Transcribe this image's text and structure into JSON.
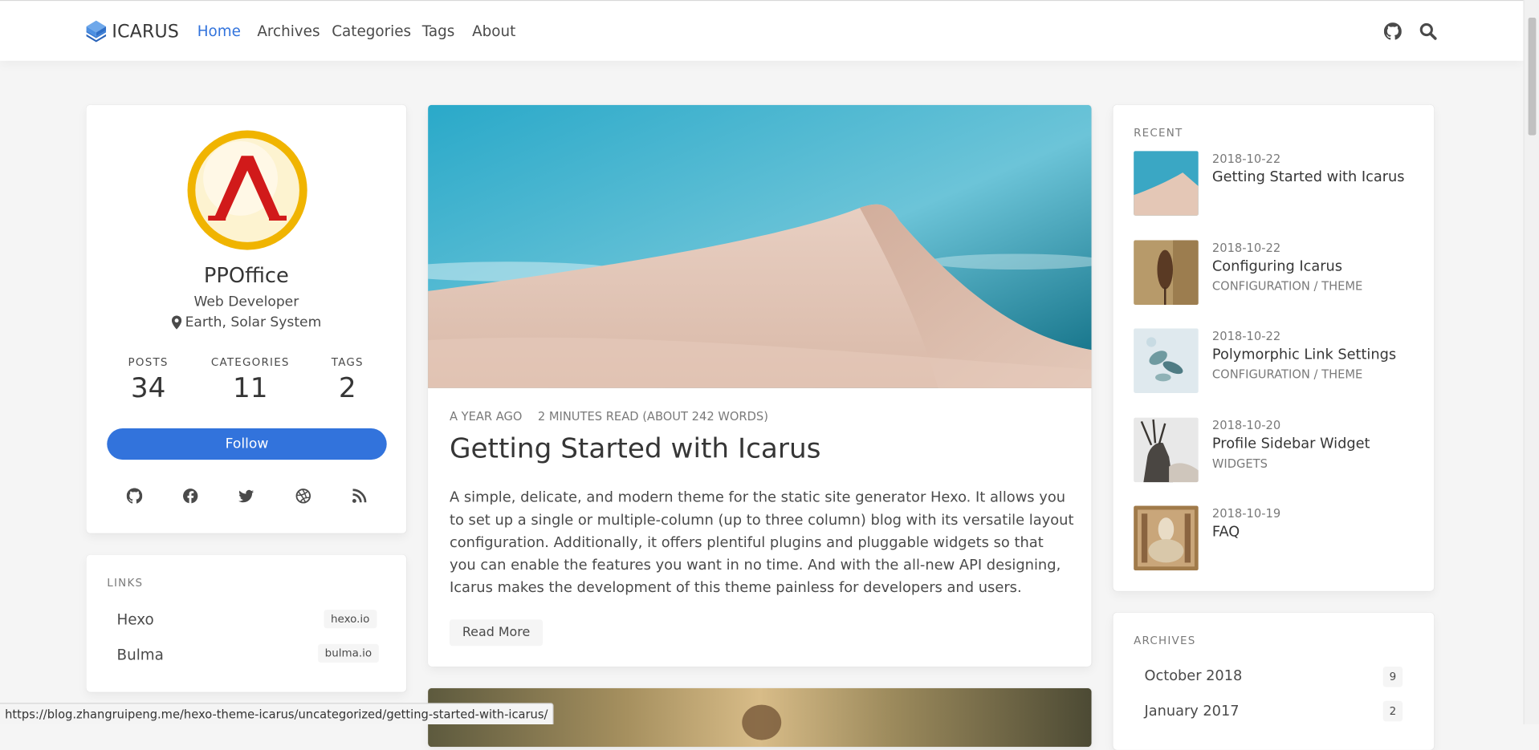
{
  "navbar": {
    "brand": "ICARUS",
    "items": [
      {
        "label": "Home",
        "active": true
      },
      {
        "label": "Archives"
      },
      {
        "label": "Categories"
      },
      {
        "label": "Tags"
      },
      {
        "label": "About"
      }
    ],
    "icons": [
      "github-icon",
      "search-icon"
    ]
  },
  "profile": {
    "name": "PPOffice",
    "title": "Web Developer",
    "location": "Earth, Solar System",
    "stats": [
      {
        "heading": "POSTS",
        "value": "34"
      },
      {
        "heading": "CATEGORIES",
        "value": "11"
      },
      {
        "heading": "TAGS",
        "value": "2"
      }
    ],
    "follow_label": "Follow",
    "socials": [
      "github-icon",
      "facebook-icon",
      "twitter-icon",
      "dribbble-icon",
      "rss-icon"
    ]
  },
  "links": {
    "heading": "LINKS",
    "items": [
      {
        "name": "Hexo",
        "tag": "hexo.io"
      },
      {
        "name": "Bulma",
        "tag": "bulma.io"
      }
    ]
  },
  "post": {
    "age": "A YEAR AGO",
    "reading": "2 MINUTES READ (ABOUT 242 WORDS)",
    "title": "Getting Started with Icarus",
    "excerpt": "A simple, delicate, and modern theme for the static site generator Hexo. It allows you to set up a single or multiple-column (up to three column) blog with its versatile layout configuration. Additionally, it offers plentiful plugins and pluggable widgets so that you can enable the features you want in no time. And with the all-new API designing, Icarus makes the development of this theme painless for developers and users.",
    "read_more": "Read More"
  },
  "recent": {
    "heading": "RECENT",
    "items": [
      {
        "date": "2018-10-22",
        "title": "Getting Started with Icarus",
        "category": ""
      },
      {
        "date": "2018-10-22",
        "title": "Configuring Icarus",
        "category": "CONFIGURATION / THEME"
      },
      {
        "date": "2018-10-22",
        "title": "Polymorphic Link Settings",
        "category": "CONFIGURATION / THEME"
      },
      {
        "date": "2018-10-20",
        "title": "Profile Sidebar Widget",
        "category": "WIDGETS"
      },
      {
        "date": "2018-10-19",
        "title": "FAQ",
        "category": ""
      }
    ]
  },
  "archives": {
    "heading": "ARCHIVES",
    "items": [
      {
        "name": "October 2018",
        "count": "9"
      },
      {
        "name": "January 2017",
        "count": "2"
      }
    ]
  },
  "status_url": "https://blog.zhangruipeng.me/hexo-theme-icarus/uncategorized/getting-started-with-icarus/",
  "colors": {
    "accent": "#3273dc",
    "background": "#f5f5f5",
    "text": "#4a4a4a"
  }
}
